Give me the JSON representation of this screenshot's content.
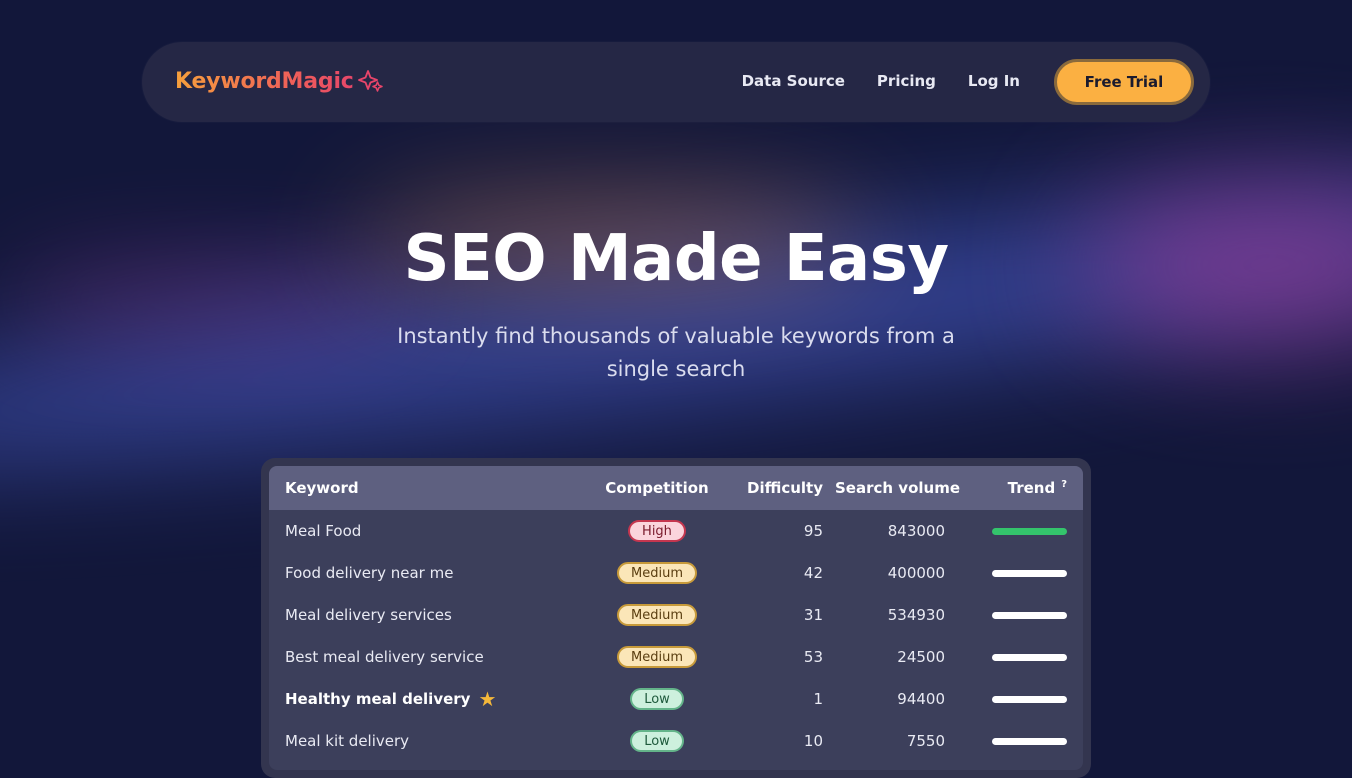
{
  "brand": {
    "name": "KeywordMagic",
    "accent": "#fbb042"
  },
  "nav": {
    "links": [
      "Data Source",
      "Pricing",
      "Log In"
    ],
    "cta": "Free Trial"
  },
  "hero": {
    "title": "SEO Made Easy",
    "subtitle": "Instantly find thousands of valuable keywords from a single search"
  },
  "table": {
    "headers": {
      "keyword": "Keyword",
      "competition": "Competition",
      "difficulty": "Difficulty",
      "volume": "Search volume",
      "trend": "Trend",
      "trend_help": "?"
    },
    "rows": [
      {
        "keyword": "Meal Food",
        "competition": "High",
        "difficulty": "95",
        "volume": "843000"
      },
      {
        "keyword": "Food delivery near me",
        "competition": "Medium",
        "difficulty": "42",
        "volume": "400000"
      },
      {
        "keyword": "Meal delivery services",
        "competition": "Medium",
        "difficulty": "31",
        "volume": "534930"
      },
      {
        "keyword": "Best meal delivery service",
        "competition": "Medium",
        "difficulty": "53",
        "volume": "24500"
      },
      {
        "keyword": "Healthy meal delivery",
        "competition": "Low",
        "difficulty": "1",
        "volume": "94400",
        "starred": true
      },
      {
        "keyword": "Meal kit delivery",
        "competition": "Low",
        "difficulty": "10",
        "volume": "7550"
      }
    ]
  }
}
